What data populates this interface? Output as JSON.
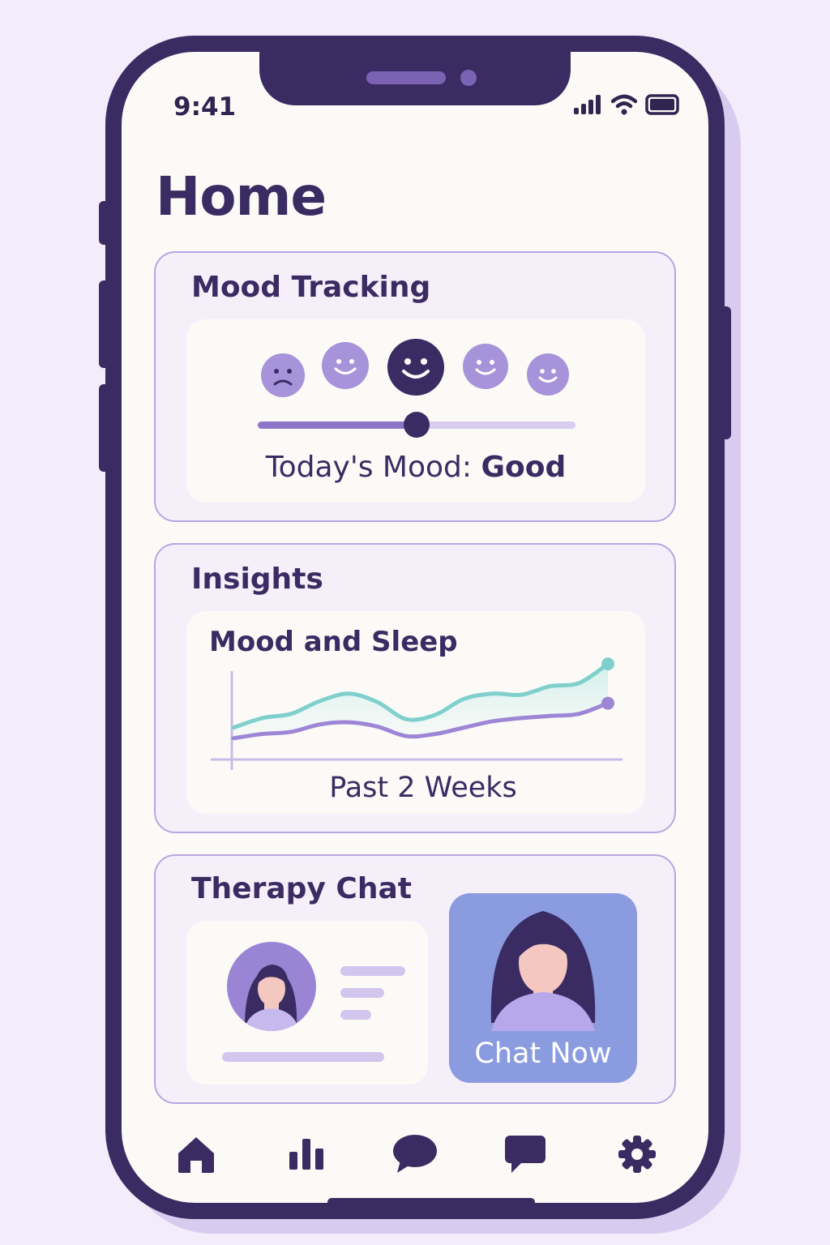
{
  "status_bar": {
    "time": "9:41",
    "icons": [
      "signal-icon",
      "wifi-icon",
      "battery-icon"
    ]
  },
  "page": {
    "title": "Home"
  },
  "mood_tracking": {
    "title": "Mood Tracking",
    "faces": [
      "sad-face-icon",
      "smiling-face-icon",
      "happy-face-icon",
      "smiling-face-icon",
      "smiling-face-icon"
    ],
    "selected_index": 2,
    "slider_level": 0.5,
    "label_prefix": "Today's Mood: ",
    "label_value": "Good"
  },
  "insights": {
    "title": "Insights",
    "chart_title": "Mood and Sleep",
    "caption": "Past 2 Weeks"
  },
  "chart_data": {
    "type": "area",
    "title": "Mood and Sleep",
    "xlabel": "Past 2 Weeks",
    "ylabel": "",
    "x": [
      1,
      2,
      3,
      4,
      5,
      6,
      7,
      8,
      9,
      10,
      11,
      12,
      13,
      14
    ],
    "series": [
      {
        "color": "#7fd0cc",
        "values": [
          3.0,
          3.9,
          4.3,
          5.5,
          6.2,
          5.4,
          3.8,
          4.2,
          5.7,
          6.2,
          6.1,
          6.9,
          7.2,
          9.0
        ]
      },
      {
        "color": "#9d86d6",
        "values": [
          2.0,
          2.4,
          2.6,
          3.3,
          3.5,
          3.1,
          2.2,
          2.4,
          3.0,
          3.6,
          3.9,
          4.1,
          4.3,
          5.3
        ]
      }
    ],
    "ylim": [
      0,
      10
    ],
    "grid": false,
    "legend": "none"
  },
  "therapy_chat": {
    "title": "Therapy Chat",
    "button_label": "Chat Now"
  },
  "tab_bar": {
    "items": [
      {
        "icon": "home-icon",
        "active": true
      },
      {
        "icon": "bar-chart-icon",
        "active": false
      },
      {
        "icon": "speech-bubble-icon",
        "active": false
      },
      {
        "icon": "message-icon",
        "active": false
      },
      {
        "icon": "gear-icon",
        "active": false
      }
    ]
  },
  "colors": {
    "primary": "#3b2b63",
    "accent": "#a793d9",
    "card_border": "#b8a6e2",
    "button": "#8a9be0",
    "teal": "#7fd0cc"
  }
}
